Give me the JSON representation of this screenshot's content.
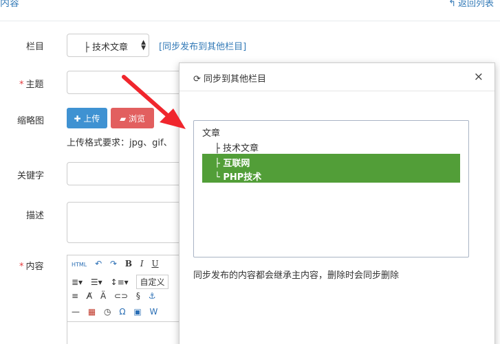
{
  "header": {
    "title": "内容",
    "back_label": "返回列表",
    "back_icon": "reply-icon"
  },
  "form": {
    "column_label": "栏目",
    "column_select_value": "├  技术文章",
    "sync_link": "[同步发布到其他栏目]",
    "subject_label": "主题",
    "thumb_label": "缩略图",
    "upload_label": "上传",
    "browse_label": "浏览",
    "upload_hint": "上传格式要求：jpg、gif、",
    "keyword_label": "关键字",
    "desc_label": "描述",
    "content_label": "内容",
    "required_mark": "*"
  },
  "editor": {
    "html_label": "HTML",
    "font_select": "自定义"
  },
  "dialog": {
    "title": "同步到其他栏目",
    "close_glyph": "×",
    "tree": [
      {
        "label": "文章",
        "selected": false
      },
      {
        "label": "├  技术文章",
        "selected": false
      },
      {
        "label": "├  互联网",
        "selected": true
      },
      {
        "label": "└  PHP技术",
        "selected": true
      }
    ],
    "note": "同步发布的内容都会继承主内容，删除时会同步删除"
  },
  "colors": {
    "link": "#337ab7",
    "upload": "#3f92d2",
    "browse": "#e25f5f",
    "selected": "#529e38",
    "arrow": "#f0262d"
  }
}
